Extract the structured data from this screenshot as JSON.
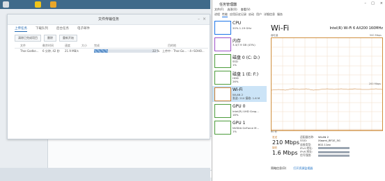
{
  "transfer_window": {
    "title": "文件传输任务",
    "tabs": [
      "上传任务",
      "下载队列",
      "后台任务",
      "电子邮件"
    ],
    "buttons": [
      "清除已完成项目",
      "删除",
      "重新开始"
    ],
    "columns": [
      "文件",
      "剩余时间",
      "速度",
      "大小",
      "完成",
      "目的地"
    ],
    "row": {
      "file": "Thor.Godke...",
      "remaining": "6 分钟, 42 秒",
      "speed": "21.9 MB/s",
      "progress": 22,
      "progress_label": "22 %",
      "destination": "上传中 - Thor.Go... - 4~SOHO..."
    }
  },
  "task_manager": {
    "title": "任务管理器",
    "menu": [
      "文件(F)",
      "选项(O)",
      "查看(V)"
    ],
    "tabs": [
      "进程",
      "性能",
      "应用历史记录",
      "启动",
      "用户",
      "详细信息",
      "服务"
    ],
    "sidebar": [
      {
        "name": "CPU",
        "sub1": "20% 1.19 GHz",
        "sub2": "",
        "color": "#1a73e8"
      },
      {
        "name": "内存",
        "sub1": "3.4/7.9 GB (43%)",
        "sub2": "",
        "color": "#9b4fc8"
      },
      {
        "name": "磁盘 0 (C: D:)",
        "sub1": "SSD",
        "sub2": "1%",
        "color": "#4b9b3a"
      },
      {
        "name": "磁盘 1 (E: F:)",
        "sub1": "HDD",
        "sub2": "26%",
        "color": "#4b9b3a"
      },
      {
        "name": "Wi-Fi",
        "sub1": "WLAN 2",
        "sub2": "发送: 210 接收: 1.6 M",
        "color": "#c77b2e"
      },
      {
        "name": "GPU 0",
        "sub1": "Intel(R) UHD Grap...",
        "sub2": "18%",
        "color": "#4b9b3a"
      },
      {
        "name": "GPU 1",
        "sub1": "NVIDIA GeForce M...",
        "sub2": "1%",
        "color": "#4b9b3a"
      }
    ],
    "main": {
      "title": "Wi-Fi",
      "device": "Intel(R) Wi-Fi 6 AX200 160MHz",
      "graph_label": "吞吐量",
      "graph_max": "500 Mbps",
      "graph_mid": "200 Mbps",
      "graph_time": "60 秒",
      "send_label": "发送",
      "send_value": "210 Mbps",
      "recv_label": "接收",
      "recv_value": "1.6 Mbps",
      "details": [
        {
          "k": "适配器名称:",
          "v": "WLAN 2"
        },
        {
          "k": "SSID:",
          "v": "Xiaomi_BF1E_5G"
        },
        {
          "k": "连接类型:",
          "v": "802.11ax"
        },
        {
          "k": "IPv4 地址:",
          "v": ""
        },
        {
          "k": "IPv6 地址:",
          "v": ""
        },
        {
          "k": "信号强度:",
          "v": ""
        }
      ]
    },
    "footer": {
      "less": "简略信息(D)",
      "open": "打开资源监视器"
    }
  }
}
